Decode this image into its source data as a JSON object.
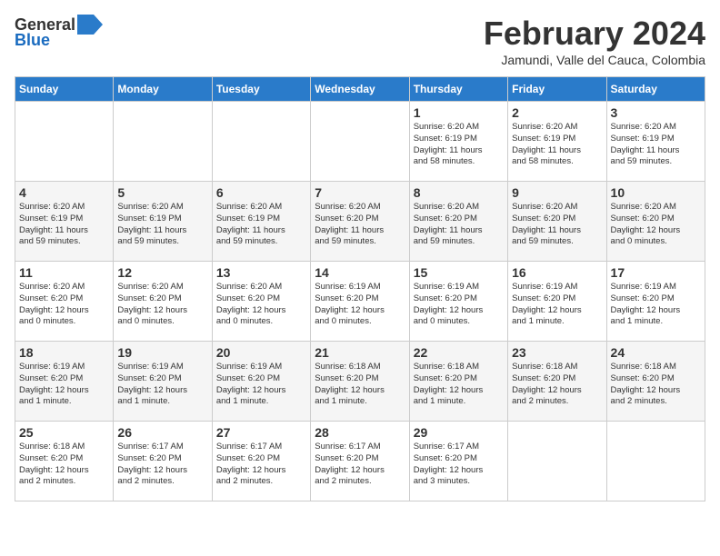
{
  "logo": {
    "general": "General",
    "blue": "Blue"
  },
  "title": "February 2024",
  "subtitle": "Jamundi, Valle del Cauca, Colombia",
  "days_of_week": [
    "Sunday",
    "Monday",
    "Tuesday",
    "Wednesday",
    "Thursday",
    "Friday",
    "Saturday"
  ],
  "weeks": [
    [
      {
        "day": "",
        "info": ""
      },
      {
        "day": "",
        "info": ""
      },
      {
        "day": "",
        "info": ""
      },
      {
        "day": "",
        "info": ""
      },
      {
        "day": "1",
        "info": "Sunrise: 6:20 AM\nSunset: 6:19 PM\nDaylight: 11 hours\nand 58 minutes."
      },
      {
        "day": "2",
        "info": "Sunrise: 6:20 AM\nSunset: 6:19 PM\nDaylight: 11 hours\nand 58 minutes."
      },
      {
        "day": "3",
        "info": "Sunrise: 6:20 AM\nSunset: 6:19 PM\nDaylight: 11 hours\nand 59 minutes."
      }
    ],
    [
      {
        "day": "4",
        "info": "Sunrise: 6:20 AM\nSunset: 6:19 PM\nDaylight: 11 hours\nand 59 minutes."
      },
      {
        "day": "5",
        "info": "Sunrise: 6:20 AM\nSunset: 6:19 PM\nDaylight: 11 hours\nand 59 minutes."
      },
      {
        "day": "6",
        "info": "Sunrise: 6:20 AM\nSunset: 6:19 PM\nDaylight: 11 hours\nand 59 minutes."
      },
      {
        "day": "7",
        "info": "Sunrise: 6:20 AM\nSunset: 6:20 PM\nDaylight: 11 hours\nand 59 minutes."
      },
      {
        "day": "8",
        "info": "Sunrise: 6:20 AM\nSunset: 6:20 PM\nDaylight: 11 hours\nand 59 minutes."
      },
      {
        "day": "9",
        "info": "Sunrise: 6:20 AM\nSunset: 6:20 PM\nDaylight: 11 hours\nand 59 minutes."
      },
      {
        "day": "10",
        "info": "Sunrise: 6:20 AM\nSunset: 6:20 PM\nDaylight: 12 hours\nand 0 minutes."
      }
    ],
    [
      {
        "day": "11",
        "info": "Sunrise: 6:20 AM\nSunset: 6:20 PM\nDaylight: 12 hours\nand 0 minutes."
      },
      {
        "day": "12",
        "info": "Sunrise: 6:20 AM\nSunset: 6:20 PM\nDaylight: 12 hours\nand 0 minutes."
      },
      {
        "day": "13",
        "info": "Sunrise: 6:20 AM\nSunset: 6:20 PM\nDaylight: 12 hours\nand 0 minutes."
      },
      {
        "day": "14",
        "info": "Sunrise: 6:19 AM\nSunset: 6:20 PM\nDaylight: 12 hours\nand 0 minutes."
      },
      {
        "day": "15",
        "info": "Sunrise: 6:19 AM\nSunset: 6:20 PM\nDaylight: 12 hours\nand 0 minutes."
      },
      {
        "day": "16",
        "info": "Sunrise: 6:19 AM\nSunset: 6:20 PM\nDaylight: 12 hours\nand 1 minute."
      },
      {
        "day": "17",
        "info": "Sunrise: 6:19 AM\nSunset: 6:20 PM\nDaylight: 12 hours\nand 1 minute."
      }
    ],
    [
      {
        "day": "18",
        "info": "Sunrise: 6:19 AM\nSunset: 6:20 PM\nDaylight: 12 hours\nand 1 minute."
      },
      {
        "day": "19",
        "info": "Sunrise: 6:19 AM\nSunset: 6:20 PM\nDaylight: 12 hours\nand 1 minute."
      },
      {
        "day": "20",
        "info": "Sunrise: 6:19 AM\nSunset: 6:20 PM\nDaylight: 12 hours\nand 1 minute."
      },
      {
        "day": "21",
        "info": "Sunrise: 6:18 AM\nSunset: 6:20 PM\nDaylight: 12 hours\nand 1 minute."
      },
      {
        "day": "22",
        "info": "Sunrise: 6:18 AM\nSunset: 6:20 PM\nDaylight: 12 hours\nand 1 minute."
      },
      {
        "day": "23",
        "info": "Sunrise: 6:18 AM\nSunset: 6:20 PM\nDaylight: 12 hours\nand 2 minutes."
      },
      {
        "day": "24",
        "info": "Sunrise: 6:18 AM\nSunset: 6:20 PM\nDaylight: 12 hours\nand 2 minutes."
      }
    ],
    [
      {
        "day": "25",
        "info": "Sunrise: 6:18 AM\nSunset: 6:20 PM\nDaylight: 12 hours\nand 2 minutes."
      },
      {
        "day": "26",
        "info": "Sunrise: 6:17 AM\nSunset: 6:20 PM\nDaylight: 12 hours\nand 2 minutes."
      },
      {
        "day": "27",
        "info": "Sunrise: 6:17 AM\nSunset: 6:20 PM\nDaylight: 12 hours\nand 2 minutes."
      },
      {
        "day": "28",
        "info": "Sunrise: 6:17 AM\nSunset: 6:20 PM\nDaylight: 12 hours\nand 2 minutes."
      },
      {
        "day": "29",
        "info": "Sunrise: 6:17 AM\nSunset: 6:20 PM\nDaylight: 12 hours\nand 3 minutes."
      },
      {
        "day": "",
        "info": ""
      },
      {
        "day": "",
        "info": ""
      }
    ]
  ]
}
